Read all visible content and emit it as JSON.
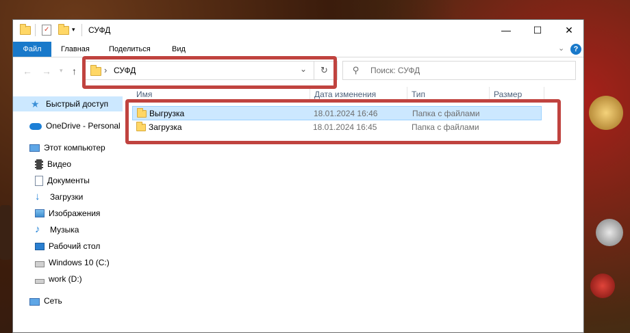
{
  "window": {
    "title": "СУФД",
    "minimize_glyph": "—",
    "maximize_glyph": "☐",
    "close_glyph": "✕"
  },
  "ribbon": {
    "tabs": [
      "Файл",
      "Главная",
      "Поделиться",
      "Вид"
    ]
  },
  "navigation": {
    "breadcrumb_separator": "›",
    "path": "СУФД",
    "search_placeholder": "Поиск: СУФД"
  },
  "sidebar": {
    "items": [
      {
        "label": "Быстрый доступ",
        "icon": "star-icon"
      },
      {
        "label": "OneDrive - Personal",
        "icon": "cloud-icon"
      },
      {
        "label": "Этот компьютер",
        "icon": "computer-icon"
      },
      {
        "label": "Видео",
        "icon": "video-icon"
      },
      {
        "label": "Документы",
        "icon": "documents-icon"
      },
      {
        "label": "Загрузки",
        "icon": "download-icon"
      },
      {
        "label": "Изображения",
        "icon": "pictures-icon"
      },
      {
        "label": "Музыка",
        "icon": "music-icon"
      },
      {
        "label": "Рабочий стол",
        "icon": "desktop-icon"
      },
      {
        "label": "Windows 10 (C:)",
        "icon": "drive-c-icon"
      },
      {
        "label": "work (D:)",
        "icon": "drive-d-icon"
      },
      {
        "label": "Сеть",
        "icon": "network-icon"
      }
    ]
  },
  "columns": [
    "Имя",
    "Дата изменения",
    "Тип",
    "Размер"
  ],
  "files": [
    {
      "name": "Выгрузка",
      "modified": "18.01.2024 16:46",
      "type": "Папка с файлами",
      "size": ""
    },
    {
      "name": "Загрузка",
      "modified": "18.01.2024 16:45",
      "type": "Папка с файлами",
      "size": ""
    }
  ],
  "colors": {
    "accent": "#1979ca",
    "highlight_box": "#c0433f",
    "selection": "#cce8ff"
  }
}
